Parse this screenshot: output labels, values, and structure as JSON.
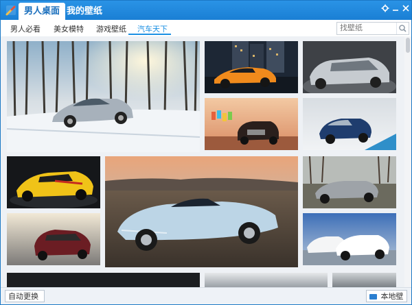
{
  "header": {
    "tabs": [
      {
        "label": "男人桌面",
        "active": true
      },
      {
        "label": "我的壁纸",
        "active": false
      }
    ]
  },
  "subnav": {
    "tabs": [
      {
        "label": "男人必看",
        "active": false
      },
      {
        "label": "美女模特",
        "active": false
      },
      {
        "label": "游戏壁纸",
        "active": false
      },
      {
        "label": "汽车天下",
        "active": true
      }
    ],
    "search_placeholder": "找壁纸"
  },
  "footer": {
    "auto_change_label": "自动更换",
    "local_wallpaper_label": "本地壁纸"
  },
  "colors": {
    "titlebar": "#1a7fd4",
    "accent": "#1a8fe3"
  },
  "icons": [
    "app-logo-icon",
    "gear-icon",
    "minimize-icon",
    "close-icon",
    "search-icon",
    "play-icon",
    "folder-icon"
  ]
}
